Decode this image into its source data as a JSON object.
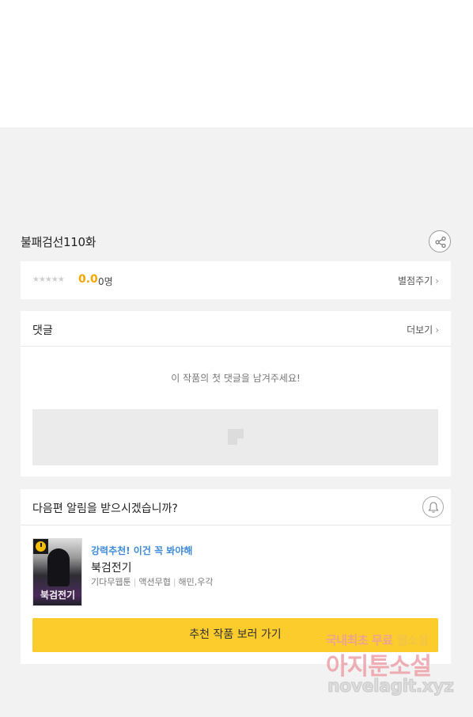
{
  "episode": {
    "title": "불패검선110화"
  },
  "rating": {
    "stars": "★★★★★",
    "score": "0.0",
    "count": "0명",
    "rate_link": "별점주기"
  },
  "comments": {
    "title": "댓글",
    "more_link": "더보기",
    "empty_message": "이 작품의 첫 댓글을 남겨주세요!"
  },
  "alarm": {
    "question": "다음편 알림을 받으시겠습니까?"
  },
  "recommendation": {
    "tag": "강력추천! 이건 꼭 봐야해",
    "title": "북검전기",
    "author": "기다무웹툰",
    "genre": "액션무협",
    "artist": "해민,우각",
    "thumb_title": "북검전기",
    "button_label": "추천 작품 보러 가기"
  },
  "watermark": {
    "line1_prefix": "국내최초 무료 ",
    "line1_highlight": "웹소설",
    "line2": "아지툰소설",
    "line3": "novelagit.xyz"
  },
  "colors": {
    "accent_yellow": "#fccb2c",
    "score_orange": "#f5a700",
    "link_blue": "#3d8ad8"
  }
}
